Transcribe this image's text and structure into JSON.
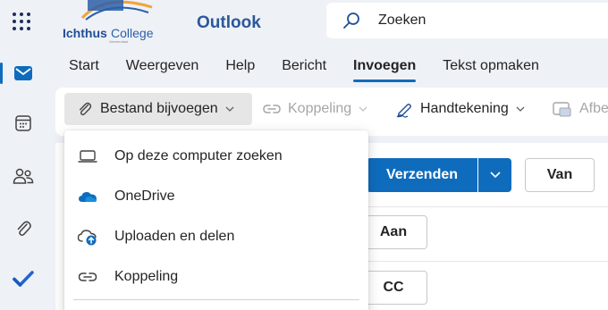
{
  "header": {
    "app_title": "Outlook",
    "logo_text": "Ichthus College",
    "search_label": "Zoeken"
  },
  "rail": {
    "items": [
      {
        "icon": "mail-icon",
        "active": true
      },
      {
        "icon": "calendar-icon",
        "active": false
      },
      {
        "icon": "people-icon",
        "active": false
      },
      {
        "icon": "attachment-icon",
        "active": false
      },
      {
        "icon": "todo-icon",
        "active": false
      }
    ]
  },
  "ribbon": {
    "tabs": [
      "Start",
      "Weergeven",
      "Help",
      "Bericht",
      "Invoegen",
      "Tekst opmaken"
    ],
    "active_tab": "Invoegen",
    "commands": {
      "attach": "Bestand bijvoegen",
      "link": "Koppeling",
      "signature": "Handtekening",
      "more": "Afbe"
    }
  },
  "attach_menu": {
    "items": [
      {
        "label": "Op deze computer zoeken",
        "icon": "laptop-icon"
      },
      {
        "label": "OneDrive",
        "icon": "onedrive-icon"
      },
      {
        "label": "Uploaden en delen",
        "icon": "cloud-upload-icon"
      },
      {
        "label": "Koppeling",
        "icon": "link-icon"
      }
    ]
  },
  "compose": {
    "send_label": "Verzenden",
    "from_label": "Van",
    "to_label": "Aan",
    "cc_label": "CC"
  },
  "colors": {
    "accent": "#0f6cbd",
    "background": "#eef1f6",
    "brand_title": "#2b579a"
  }
}
